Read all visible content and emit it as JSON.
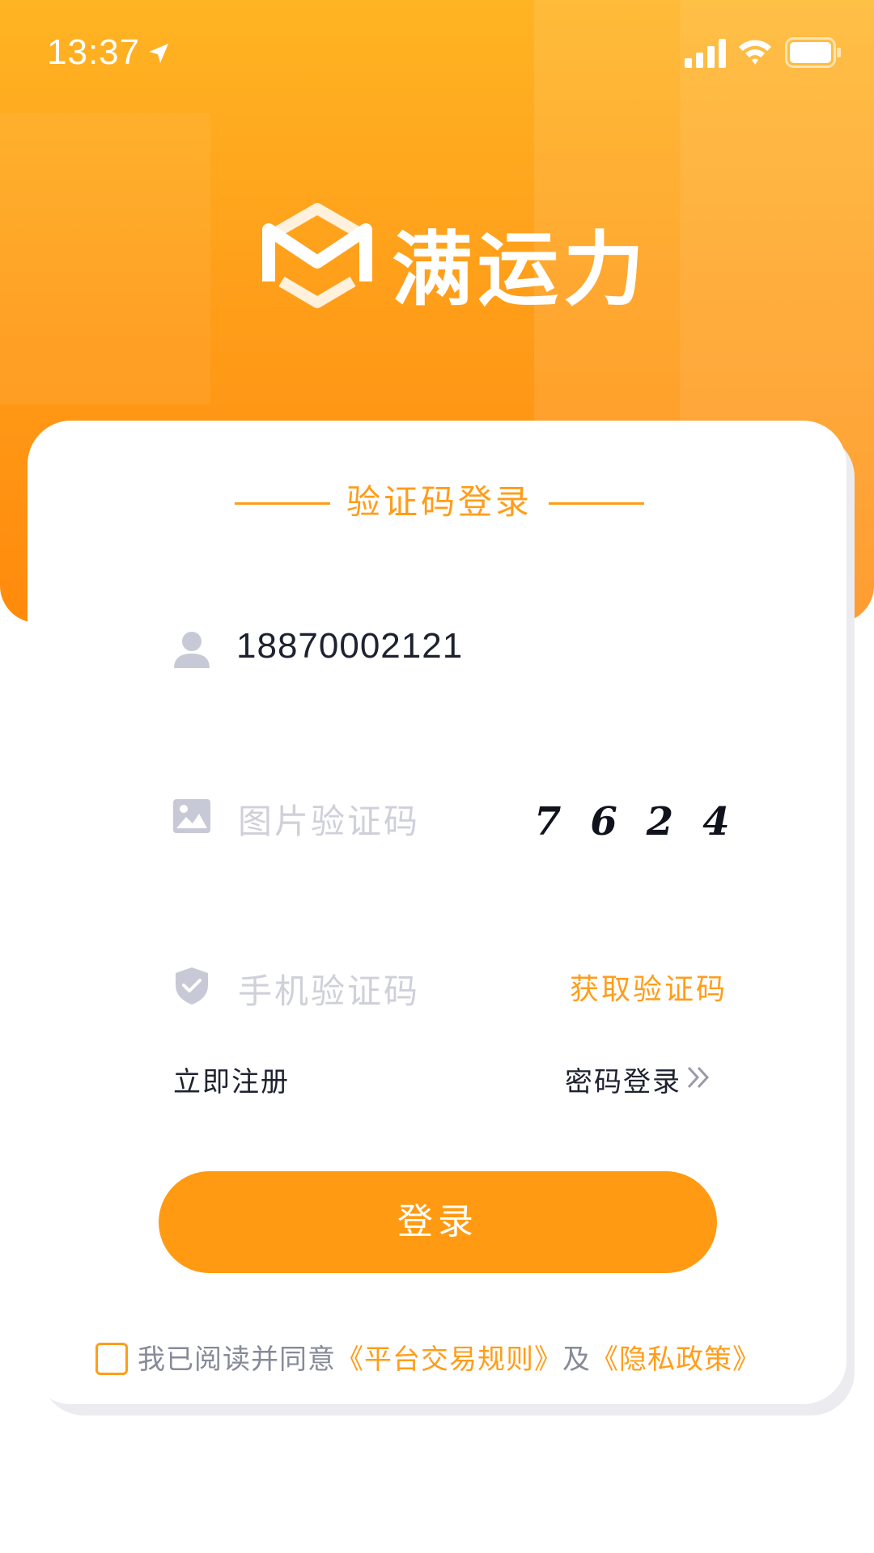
{
  "status_bar": {
    "time": "13:37",
    "icons": [
      "location-arrow-icon",
      "cellular-signal-icon",
      "wifi-icon",
      "battery-icon"
    ]
  },
  "header": {
    "logo_icon": "brand-m-cube-icon",
    "brand_name": "满运力"
  },
  "login_card": {
    "title": "验证码登录",
    "phone": {
      "icon": "user-icon",
      "value": "18870002121"
    },
    "image_captcha": {
      "icon": "image-icon",
      "placeholder": "图片验证码",
      "captcha_code": "7624"
    },
    "sms_code": {
      "icon": "shield-check-icon",
      "placeholder": "手机验证码",
      "get_code_label": "获取验证码"
    },
    "register_label": "立即注册",
    "password_login_label": "密码登录",
    "login_button_label": "登录",
    "agreement": {
      "checked": false,
      "prefix": "我已阅读并同意",
      "rules_link": "《平台交易规则》",
      "conjunction": "及",
      "privacy_link": "《隐私政策》"
    }
  },
  "colors": {
    "accent": "#ff9d1a",
    "header_top": "#ffb423",
    "header_bottom": "#ff8a0c",
    "text_dark": "#1e2230",
    "placeholder": "#cfd0da",
    "icon_gray": "#c8c9d6"
  }
}
